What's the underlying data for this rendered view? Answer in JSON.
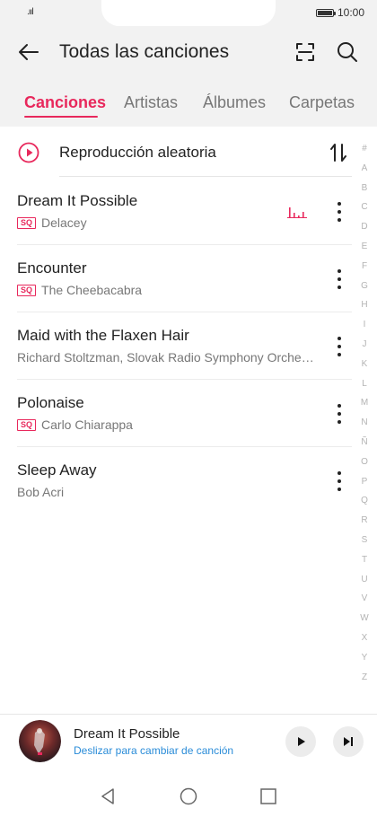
{
  "status": {
    "signal": ".ııl",
    "time": "10:00"
  },
  "header": {
    "title": "Todas las canciones"
  },
  "tabs": [
    {
      "label": "Canciones"
    },
    {
      "label": "Artistas"
    },
    {
      "label": "Álbumes"
    },
    {
      "label": "Carpetas"
    }
  ],
  "shuffle": {
    "label": "Reproducción aleatoria"
  },
  "songs": [
    {
      "title": "Dream It Possible",
      "artist": "Delacey",
      "sq": "SQ",
      "playing": true
    },
    {
      "title": "Encounter",
      "artist": "The Cheebacabra",
      "sq": "SQ"
    },
    {
      "title": "Maid with the Flaxen Hair",
      "artist": "Richard Stoltzman, Slovak Radio Symphony Orche…"
    },
    {
      "title": "Polonaise",
      "artist": "Carlo Chiarappa",
      "sq": "SQ"
    },
    {
      "title": "Sleep Away",
      "artist": "Bob Acri"
    }
  ],
  "index_letters": [
    "#",
    "A",
    "B",
    "C",
    "D",
    "E",
    "F",
    "G",
    "H",
    "I",
    "J",
    "K",
    "L",
    "M",
    "N",
    "Ñ",
    "O",
    "P",
    "Q",
    "R",
    "S",
    "T",
    "U",
    "V",
    "W",
    "X",
    "Y",
    "Z"
  ],
  "player": {
    "title": "Dream It Possible",
    "subtitle": "Deslizar para cambiar de canción"
  },
  "colors": {
    "accent": "#e8285c",
    "link": "#2a8cd8"
  }
}
